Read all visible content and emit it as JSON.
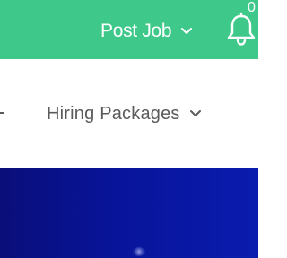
{
  "header": {
    "post_job_label": "Post Job",
    "notification_count": "0"
  },
  "nav": {
    "hiring_packages_label": "Hiring Packages"
  },
  "colors": {
    "header_bg": "#3ec98b",
    "hero_bg": "#0a18a0",
    "nav_text": "#5b5b5b"
  },
  "icons": {
    "post_job_chevron": "chevron-down-icon",
    "bell": "bell-icon",
    "hiring_chevron": "chevron-down-icon"
  }
}
